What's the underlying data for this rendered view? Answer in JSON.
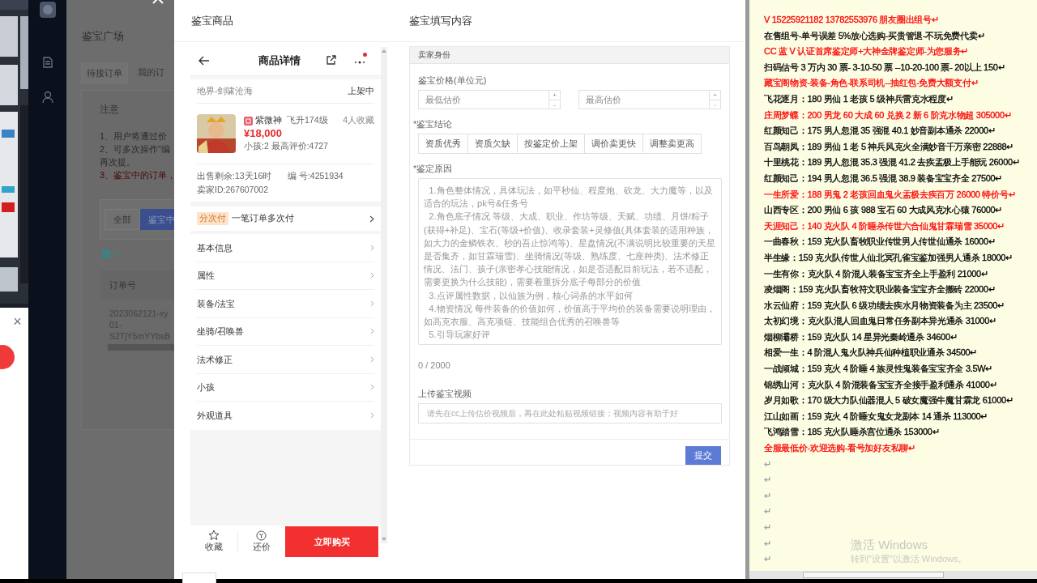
{
  "background_app": {
    "popup_close": "×"
  },
  "page": {
    "title": "鉴宝广场",
    "tabs": [
      {
        "label": "待接订单",
        "selected": true
      },
      {
        "label": "我的订",
        "selected": false
      }
    ],
    "notice": {
      "title": "注意",
      "lines": [
        {
          "text": "1、用户将通过价",
          "kind": "normal"
        },
        {
          "text": "2、可多次操作\"编",
          "kind": "normal"
        },
        {
          "text": "再次提。",
          "kind": "normal"
        },
        {
          "text": "3、鉴宝中的订单，",
          "kind": "warning"
        }
      ]
    },
    "filters": [
      {
        "label": "全部",
        "selected": false
      },
      {
        "label": "鉴宝中",
        "selected": true
      }
    ],
    "table": {
      "columns": [
        "订单号"
      ],
      "rows": [
        [
          "2023062121-xy",
          "01-",
          "S2TjY5mYYbsB"
        ]
      ]
    }
  },
  "modal": {
    "left_title": "鉴宝商品",
    "right_title": "鉴宝填写内容",
    "product": {
      "title": "商品详情",
      "server": "地界-剑啸沧海",
      "status": "上架中",
      "role": "紫微神",
      "level": "飞升174级",
      "favorites": "4人收藏",
      "price": "¥18,000",
      "meta": "小孩:2 最高评价:4727",
      "time_left": "出售剩余:13天16时",
      "number": "编 号:4251934",
      "seller": "卖家ID:267607002",
      "installment": {
        "tag": "分次付",
        "text": "一笔订单多次付"
      },
      "sections": [
        "基本信息",
        "属性",
        "装备/法宝",
        "坐骑/召唤兽",
        "法术修正",
        "小孩",
        "外观道具"
      ],
      "actions": {
        "favorite": "收藏",
        "bargain": "还价",
        "buy": "立即购买"
      },
      "has_notification": true
    },
    "form": {
      "header": "卖家身份",
      "price_label": "鉴宝价格(单位元)",
      "min_placeholder": "最低估价",
      "max_placeholder": "最高估价",
      "plus": "+",
      "minus": "-",
      "conclusion_label": "*鉴宝结论",
      "conclusions": [
        {
          "label": "资质优秀",
          "selected": false
        },
        {
          "label": "资质欠缺",
          "selected": false
        },
        {
          "label": "按鉴定价上架",
          "selected": false
        },
        {
          "label": "调价卖更快",
          "selected": false
        },
        {
          "label": "调整卖更高",
          "selected": false
        }
      ],
      "reason_label": "*鉴定原因",
      "reason_placeholder": "  1.角色整体情况，具体玩法，如平秒仙、程度炮、砍龙、大力魔等，以及适合的玩法，pk号&任务号\n  2.角色底子情况 等级、大成、职业、作坊等级、天赋、功绩、月饼/粽子(获得+补足)、宝石(等级+价值)、收录套装+灵修值(具体套装的适用种族，如大力的金鳞铁衣、秒的吾止惊鸿等)、星盘情况(不满说明比较重要的天星是否集齐，如甘霖瑞雪)、坐骑情况(等级、熟练度、七座种类)、法术修正情况、法门、孩子(亲密孝心技能情况，如是否适配目前玩法，若不适配，需要更换为什么技能)，需要着重拆分底子每部分的价值\n  3.点评属性数据，以仙族为例，核心词条的水平如何\n  4.物资情况 每件装备的价值如何，价值高于平均价的装备需要说明理由，如高克衣服、高克项链、技能组合优秀的召唤兽等\n  5.引导玩家好评",
      "counter": "0 / 2000",
      "video_label": "上传鉴宝视频",
      "video_placeholder": "请先在cc上传估价视频后，再在此处粘贴视频链接；视频内容有助于好",
      "submit": "提交"
    }
  },
  "document": {
    "lines": [
      {
        "text": "V 15225921182   13782553976 朋友圈出组号↵",
        "color": "#ff0000"
      },
      {
        "text": "在售组号-单号误差 5%放心选购-买贵管退-不玩免费代卖↵",
        "color": "#000000"
      },
      {
        "text": "CC 蓝 V 认证首席鉴定师+大神金牌鉴定师-为您服务↵",
        "color": "#ff0000"
      },
      {
        "text": "扫码估号 3 万内 30 票- 3-10-50 票  --10-20-100 票- 20以上 150↵",
        "color": "#000000"
      },
      {
        "text": "藏宝阁物资-装备-角色-联系司机--抽红包-免费大额支付↵",
        "color": "#ff0000"
      },
      {
        "text": "飞花逐月：180 男仙 1 老孩 5 级神兵雷克水程度↵",
        "color": "#000000"
      },
      {
        "text": "庄周梦蝶：200 男龙 60 大成 60 兑换 2 新 6 阶克水物超 305000↵",
        "color": "#ff0000"
      },
      {
        "text": "红颜知己：175 男人忽混 35 强混 40.1 妙音副本通杀 22000↵",
        "color": "#000000"
      },
      {
        "text": "百鸟朝凤：189 男仙 1 老 5 神兵风克火全满妙音千万亲密 22888↵",
        "color": "#000000"
      },
      {
        "text": "十里桃花：189 男人忽混 35.3 强混 41.2 去疾盂极上手能玩 26000↵",
        "color": "#000000"
      },
      {
        "text": "红颜知己：194 男人忽混 36.5 强混 38.9 装备宝宝齐全 27500↵",
        "color": "#000000"
      },
      {
        "text": "一生所爱：188 男鬼 2 老孩回血鬼火盂极去疾百万 26000 特价号↵",
        "color": "#ff0000"
      },
      {
        "text": "山西专区：200 男仙 6 孩 988 宝石 60 大成风克水心猿 76000↵",
        "color": "#000000"
      },
      {
        "text": "天涯知己：140 克火队 4 阶睡杀传世六合仙鬼甘霖瑞雪 35000↵",
        "color": "#ff0000"
      },
      {
        "text": "一曲春秋：159 克火队畜牧职业传世男人传世仙通杀 16000↵",
        "color": "#000000"
      },
      {
        "text": "半生缘：159 克火队传世人仙北冥孔雀宝鉴加强男人通杀 18000↵",
        "color": "#000000"
      },
      {
        "text": "一生有你：克火队 4 阶混人装备宝宝齐全上手盈利 21000↵",
        "color": "#000000"
      },
      {
        "text": "凌烟阁：159 克火队畜牧符文职业装备宝宝齐全搬砖 22000↵",
        "color": "#000000"
      },
      {
        "text": "水云仙府：159 克火队 6 级功绩去疾水月物资装备为主 23500↵",
        "color": "#000000"
      },
      {
        "text": "太初幻境：克火队混人回血鬼日常任务副本异光通杀 31000↵",
        "color": "#000000"
      },
      {
        "text": "烟柳灞桥：159 克火队 14 星异光秦岭通杀 34600↵",
        "color": "#000000"
      },
      {
        "text": "相爱一生：4 阶混人鬼火队神兵仙种植职业通杀 34500↵",
        "color": "#000000"
      },
      {
        "text": "一战倾城：159 克火 4 阶睡 4 族灵性鬼装备宝宝齐全 3.5W↵",
        "color": "#000000"
      },
      {
        "text": "锦绣山河：克火队 4 阶混装备宝宝齐全接手盈利通杀 41000↵",
        "color": "#000000"
      },
      {
        "text": "岁月如歌：170 级大力队仙器混人 5 破女魔强牛魔甘霖龙 61000↵",
        "color": "#000000"
      },
      {
        "text": "江山如画：159 克火 4 阶睡女鬼女龙副本 14 通杀 113000↵",
        "color": "#000000"
      },
      {
        "text": "飞鸿踏雪：185 克火队睡杀宫位通杀 153000↵",
        "color": "#000000"
      },
      {
        "text": "全服最低价-欢迎选购-看号加好友私聊↵",
        "color": "#ff0000"
      },
      {
        "text": "↵",
        "color": "#9ca3af"
      },
      {
        "text": "↵",
        "color": "#9ca3af"
      },
      {
        "text": "↵",
        "color": "#9ca3af"
      },
      {
        "text": "↵",
        "color": "#9ca3af"
      },
      {
        "text": "↵",
        "color": "#9ca3af"
      },
      {
        "text": "↵",
        "color": "#9ca3af"
      },
      {
        "text": "↵",
        "color": "#9ca3af"
      }
    ]
  },
  "os_notice": {
    "title": "激活 Windows",
    "subtitle": "转到\"设置\"以激活 Windows。"
  }
}
